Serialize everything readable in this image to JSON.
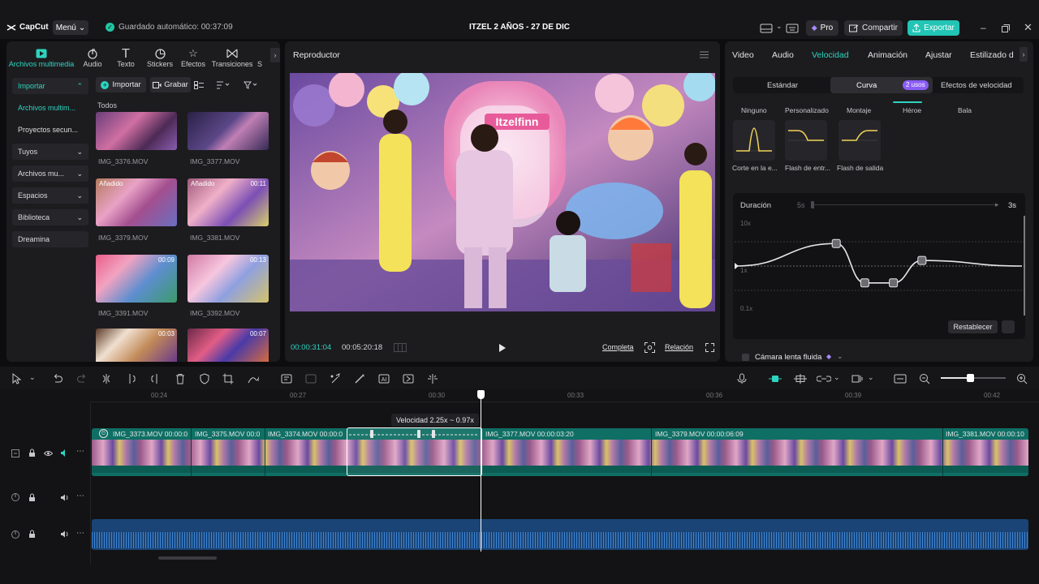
{
  "app": {
    "logo": "CapCut",
    "menu": "Menú",
    "autosave": "Guardado automático: 00:37:09",
    "project_title": "ITZEL 2 AÑOS - 27 DE DIC",
    "pro": "Pro",
    "share": "Compartir",
    "export": "Exportar"
  },
  "left_tabs": [
    {
      "label": "Archivos multimedia",
      "icon": "media-icon",
      "active": true
    },
    {
      "label": "Audio",
      "icon": "audio-icon"
    },
    {
      "label": "Texto",
      "icon": "text-icon"
    },
    {
      "label": "Stickers",
      "icon": "sticker-icon"
    },
    {
      "label": "Efectos",
      "icon": "effects-icon"
    },
    {
      "label": "Transiciones",
      "icon": "transitions-icon"
    },
    {
      "label": "S",
      "icon": ""
    }
  ],
  "side_nav": [
    {
      "label": "Importar",
      "caret": "⌃",
      "active": true
    },
    {
      "label": "Archivos multim...",
      "caret": "",
      "plain": true,
      "active": true
    },
    {
      "label": "Proyectos secun...",
      "caret": "",
      "plain": true
    },
    {
      "label": "Tuyos",
      "caret": "⌄"
    },
    {
      "label": "Archivos mu...",
      "caret": "⌄"
    },
    {
      "label": "Espacios",
      "caret": "⌄"
    },
    {
      "label": "Biblioteca",
      "caret": "⌄"
    },
    {
      "label": "Dreamina",
      "caret": ""
    }
  ],
  "media_toolbar": {
    "import": "Importar",
    "record": "Grabar",
    "all": "Todos"
  },
  "media_items": [
    {
      "name": "IMG_3376.MOV",
      "duration": "",
      "added": ""
    },
    {
      "name": "IMG_3377.MOV",
      "duration": "",
      "added": ""
    },
    {
      "name": "IMG_3379.MOV",
      "duration": "",
      "added": "Añadido"
    },
    {
      "name": "IMG_3381.MOV",
      "duration": "00:11",
      "added": "Añadido"
    },
    {
      "name": "IMG_3391.MOV",
      "duration": "00:09",
      "added": ""
    },
    {
      "name": "IMG_3392.MOV",
      "duration": "00:13",
      "added": ""
    },
    {
      "name": "",
      "duration": "00:03",
      "added": ""
    },
    {
      "name": "",
      "duration": "00:07",
      "added": ""
    }
  ],
  "player": {
    "title": "Reproductor",
    "current_time": "00:00:31:04",
    "total_time": "00:05:20:18",
    "full": "Completa",
    "ratio": "Relación",
    "video_sign": "Itzelfinn"
  },
  "right_tabs": [
    {
      "label": "Video"
    },
    {
      "label": "Audio"
    },
    {
      "label": "Velocidad",
      "active": true
    },
    {
      "label": "Animación"
    },
    {
      "label": "Ajustar"
    },
    {
      "label": "Estilizado d"
    }
  ],
  "speed": {
    "mode_tabs": [
      {
        "label": "Estándar"
      },
      {
        "label": "Curva",
        "active": true
      },
      {
        "label": "Efectos de velocidad"
      }
    ],
    "uses_badge": "2 usos",
    "presets_row1": [
      "Ninguno",
      "Personalizado",
      "Montaje",
      "Héroe",
      "Bala"
    ],
    "presets_row2": [
      "Corte en la e...",
      "Flash de entr...",
      "Flash de salida"
    ],
    "duration_label": "Duración",
    "duration_min": "5s",
    "duration_value": "3s",
    "y_labels": [
      "10x",
      "1x",
      "0.1x"
    ],
    "curve_points": [
      {
        "t": 0.0,
        "speed": 1.0
      },
      {
        "t": 0.35,
        "speed": 2.9
      },
      {
        "t": 0.45,
        "speed": 0.45
      },
      {
        "t": 0.55,
        "speed": 0.45
      },
      {
        "t": 0.65,
        "speed": 1.3
      },
      {
        "t": 1.0,
        "speed": 1.0
      }
    ],
    "reset": "Restablecer",
    "smooth_slowmo": "Cámara lenta fluida"
  },
  "timeline": {
    "ruler": [
      "00:24",
      "00:27",
      "00:30",
      "00:33",
      "00:36",
      "00:39",
      "00:42"
    ],
    "tooltip": "Velocidad 2.25x ~ 0.97x",
    "clips": [
      {
        "label": "IMG_3373.MOV  00:00:0"
      },
      {
        "label": "IMG_3375.MOV  00:0"
      },
      {
        "label": "IMG_3374.MOV  00:00:0"
      },
      {
        "label": "IMG_3377.MOV  00:00:03:20"
      },
      {
        "label": "IMG_3379.MOV  00:00:06:09"
      },
      {
        "label": "IMG_3381.MOV  00:00:10"
      }
    ]
  },
  "colors": {
    "accent": "#2dd4bf",
    "clip": "#0f6f64",
    "audio": "#1f4f86",
    "export": "#22c5b5"
  }
}
